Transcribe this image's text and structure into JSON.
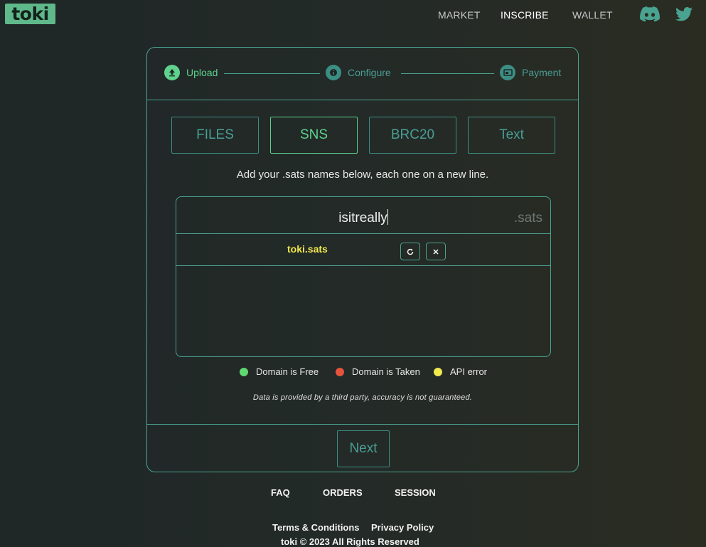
{
  "header": {
    "logo": "toki",
    "nav": {
      "market": "MARKET",
      "inscribe": "INSCRIBE",
      "wallet": "WALLET"
    },
    "social": [
      "discord-icon",
      "twitter-icon"
    ]
  },
  "steps": [
    {
      "label": "Upload",
      "state": "active",
      "icon": "upload-icon"
    },
    {
      "label": "Configure",
      "state": "pending",
      "icon": "info-icon"
    },
    {
      "label": "Payment",
      "state": "pending",
      "icon": "payment-icon"
    }
  ],
  "tabs": [
    {
      "label": "FILES"
    },
    {
      "label": "SNS",
      "selected": true
    },
    {
      "label": "BRC20"
    },
    {
      "label": "Text"
    }
  ],
  "sns": {
    "instructions": "Add your .sats names below, each one on a new line.",
    "input_value": "isitreally",
    "suffix": ".sats",
    "rows": [
      {
        "name": "toki.sats",
        "status": "api-error"
      }
    ]
  },
  "legend": [
    {
      "label": "Domain is Free",
      "color": "#5fd86f"
    },
    {
      "label": "Domain is Taken",
      "color": "#e5533d"
    },
    {
      "label": "API error",
      "color": "#f2e94e"
    }
  ],
  "disclaimer": "Data is provided by a third party, accuracy is not guaranteed.",
  "next_label": "Next",
  "footer": {
    "links": [
      "FAQ",
      "ORDERS",
      "SESSION"
    ],
    "legal": [
      "Terms & Conditions",
      "Privacy Policy"
    ],
    "copyright": "toki © 2023 All Rights Reserved"
  },
  "colors": {
    "accent_green": "#5fd28e",
    "teal": "#4aa391",
    "warning_yellow": "#f2e94e"
  }
}
